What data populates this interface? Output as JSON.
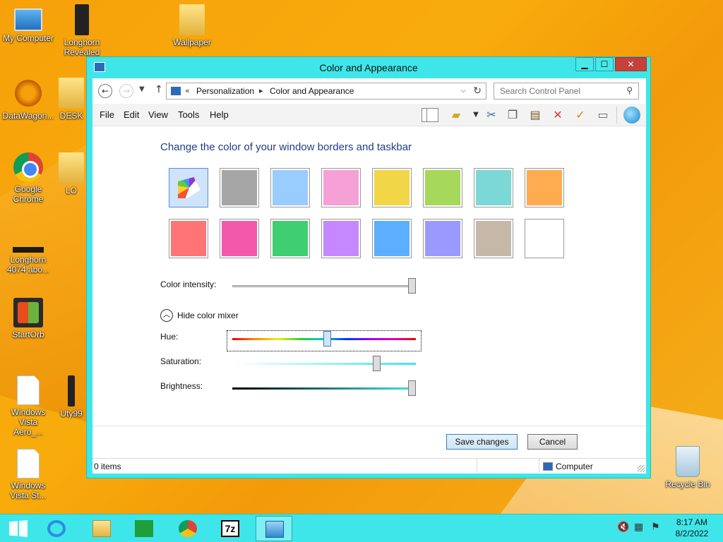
{
  "desktop": {
    "icons": [
      {
        "label": "My Computer",
        "icon": "computer-icon"
      },
      {
        "label": "Longhorn Revealed ORB",
        "icon": "film-icon"
      },
      {
        "label": "Wallpaper",
        "icon": "folder-icon"
      },
      {
        "label": "DataWagon...",
        "icon": "datawagon-icon"
      },
      {
        "label": "DESK",
        "icon": "folder-icon"
      },
      {
        "label": "Google Chrome",
        "icon": "chrome-icon"
      },
      {
        "label": "LO",
        "icon": "folder-icon"
      },
      {
        "label": "Longhorn 4074 abo...",
        "icon": "bar-icon"
      },
      {
        "label": "StartOrb",
        "icon": "startorb-icon"
      },
      {
        "label": "Windows Vista Aero_...",
        "icon": "document-icon"
      },
      {
        "label": "Uty99",
        "icon": "film-icon"
      },
      {
        "label": "Windows Vista St...",
        "icon": "document-icon"
      },
      {
        "label": "Recycle Bin",
        "icon": "recycle-bin-icon"
      }
    ]
  },
  "window": {
    "title": "Color and Appearance",
    "buttons": {
      "minimize": "▁",
      "maximize": "☐",
      "close": "✕"
    }
  },
  "address": {
    "prefix": "«",
    "crumbs": [
      "Personalization",
      "Color and Appearance"
    ],
    "separator": "▸"
  },
  "search": {
    "placeholder": "Search Control Panel"
  },
  "menu": [
    "File",
    "Edit",
    "View",
    "Tools",
    "Help"
  ],
  "toolbar": [
    "panel-icon",
    "folder-check-icon",
    "cut-icon",
    "copy-icon",
    "paste-icon",
    "delete-icon",
    "checkmark-icon",
    "properties-icon",
    "globe-icon"
  ],
  "main": {
    "heading": "Change the color of your window borders and taskbar",
    "swatches": [
      "#palette",
      "#a6a6a6",
      "#99ccff",
      "#f5a1d6",
      "#f1d648",
      "#a6d85c",
      "#7cd8d6",
      "#ffab4f",
      "#ff7474",
      "#f359ab",
      "#3fcf70",
      "#c688ff",
      "#5caefe",
      "#9a9afe",
      "#c5b8a9",
      "#ffffff"
    ],
    "selected_swatch": 0,
    "intensity_label": "Color intensity:",
    "intensity_value": 1.0,
    "mixer_toggle": "Hide color mixer",
    "hue_label": "Hue:",
    "hue_value": 0.52,
    "saturation_label": "Saturation:",
    "saturation_value": 0.8,
    "brightness_label": "Brightness:",
    "brightness_value": 1.0
  },
  "actions": {
    "save": "Save changes",
    "cancel": "Cancel"
  },
  "status": {
    "items": "0 items",
    "location": "Computer"
  },
  "taskbar": {
    "items": [
      "start-icon",
      "ie-icon",
      "file-explorer-icon",
      "store-icon",
      "chrome-icon",
      "7zip-icon",
      "control-panel-icon"
    ],
    "sevenzip_label": "7z",
    "time": "8:17 AM",
    "date": "8/2/2022"
  }
}
